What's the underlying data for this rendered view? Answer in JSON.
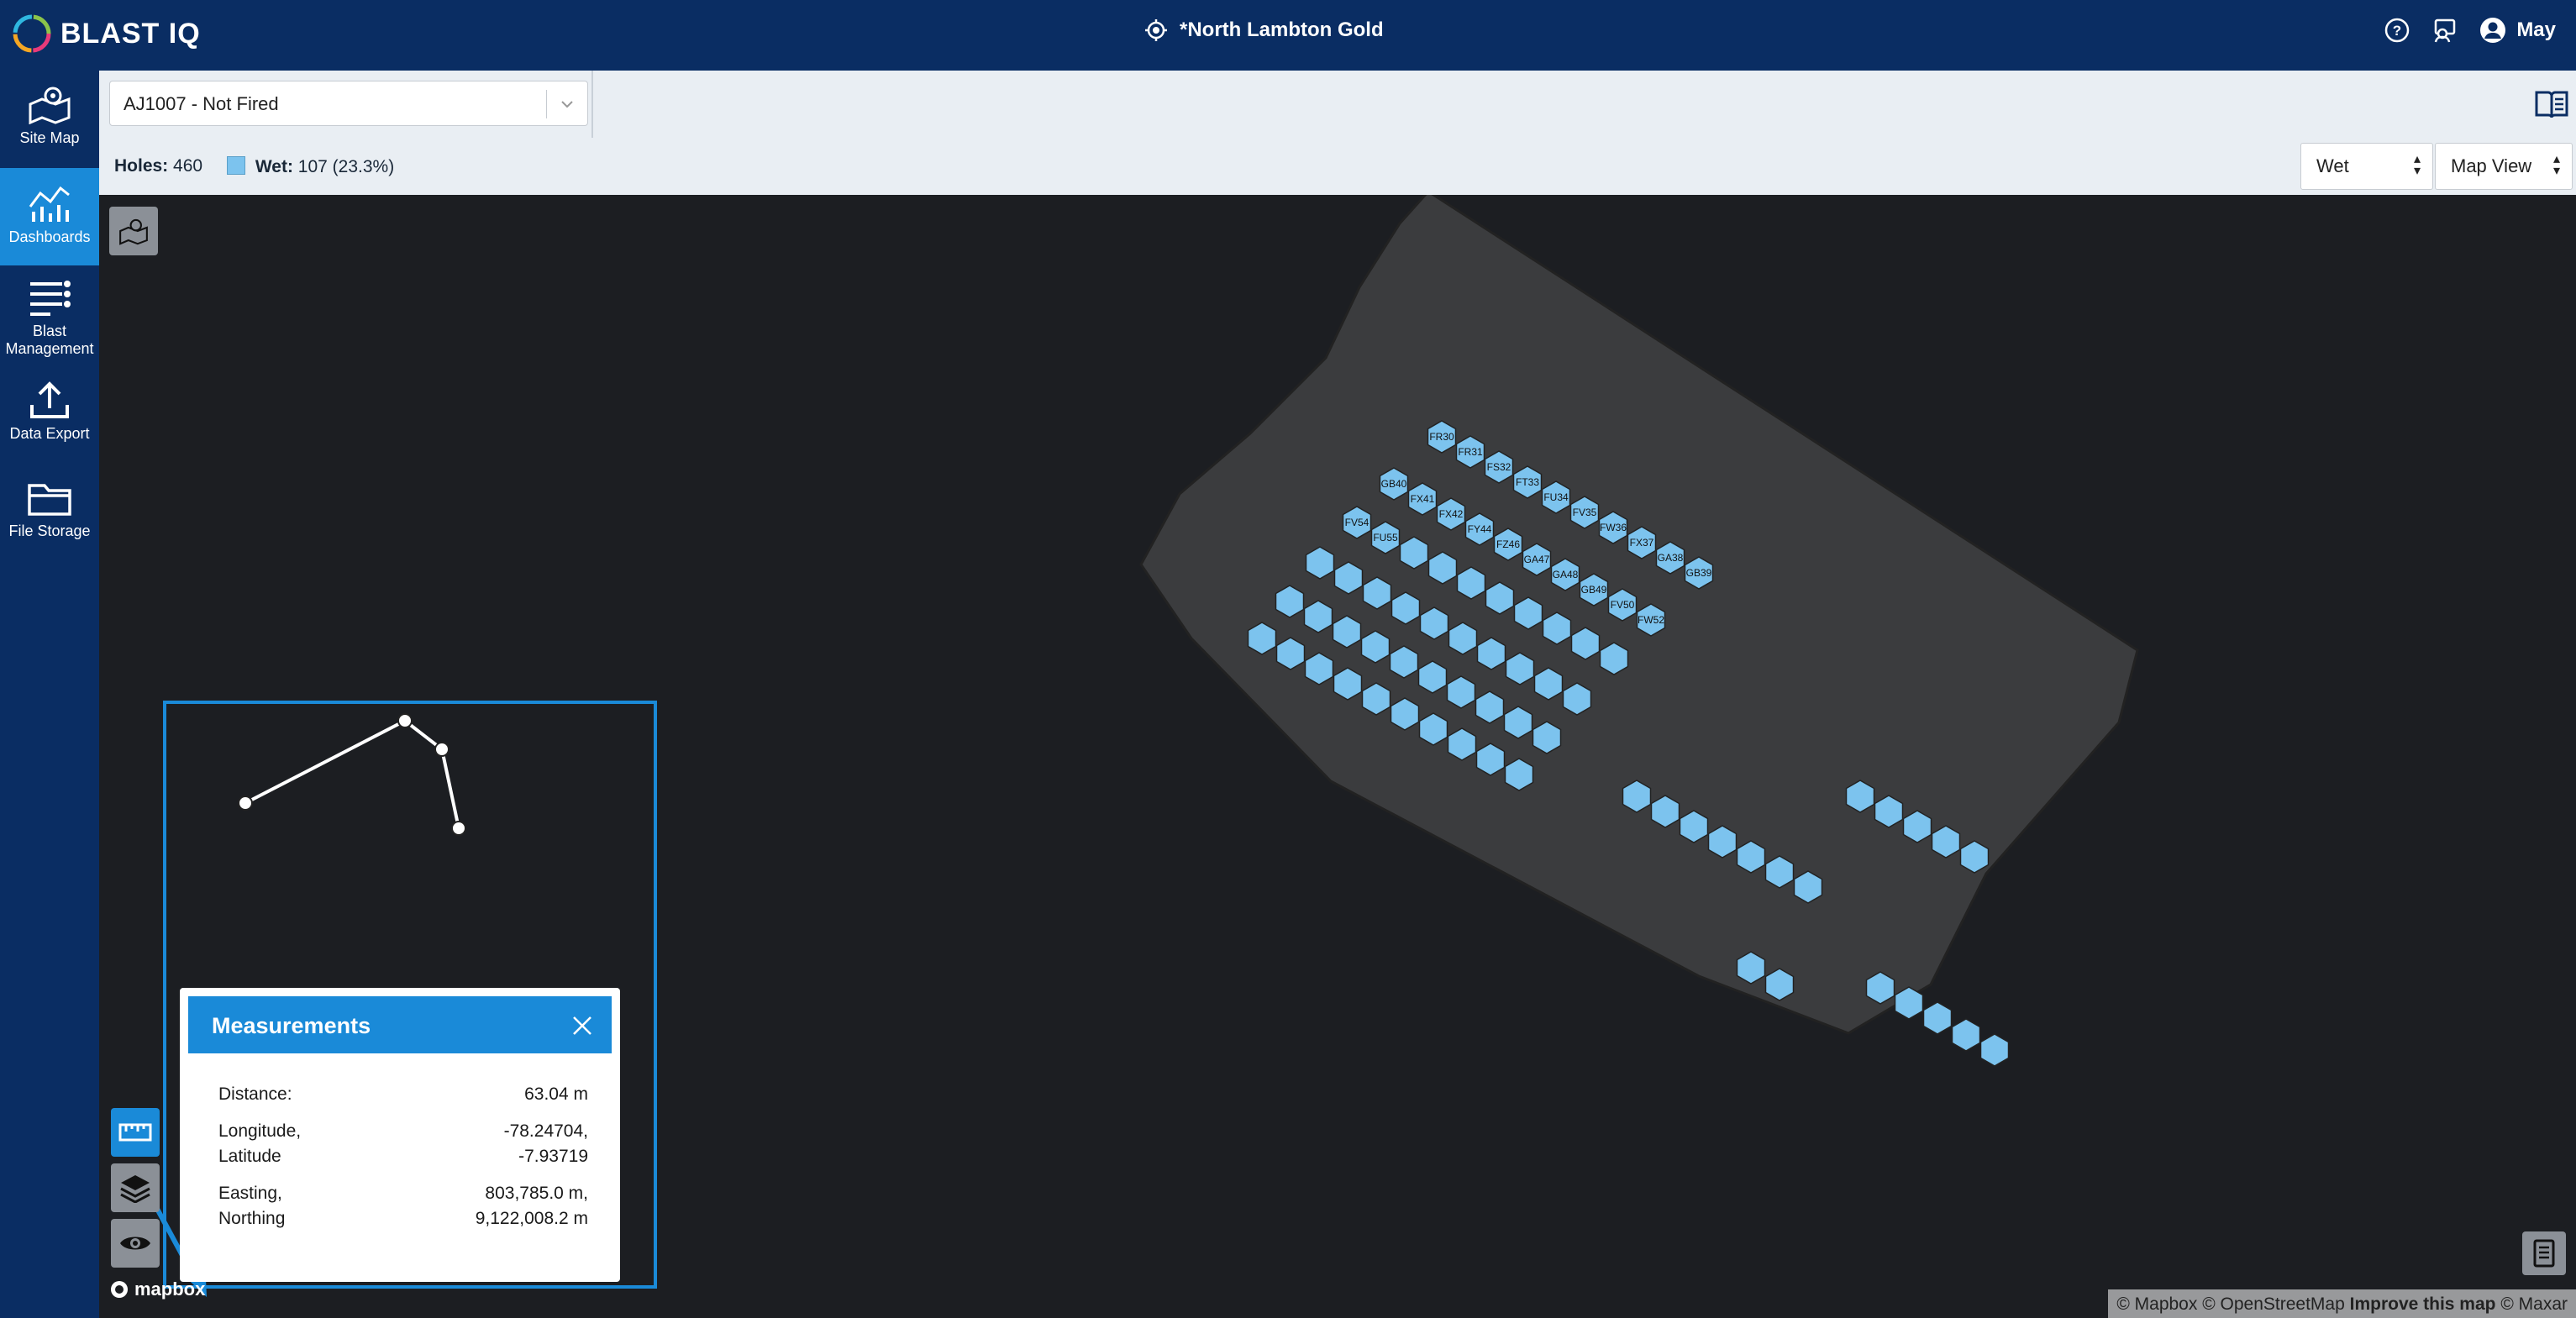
{
  "app": {
    "logo_text": "BLAST IQ",
    "site_title": "*North Lambton Gold",
    "user_name": "May"
  },
  "sidebar": {
    "items": [
      {
        "label": "Site Map",
        "icon": "site-map-icon"
      },
      {
        "label": "Dashboards",
        "icon": "dashboard-icon"
      },
      {
        "label": "Blast Management",
        "icon": "blast-management-icon"
      },
      {
        "label": "Data Export",
        "icon": "upload-icon"
      },
      {
        "label": "File Storage",
        "icon": "folder-icon"
      }
    ]
  },
  "blast_select": {
    "value": "AJ1007 - Not Fired"
  },
  "status": {
    "holes_label": "Holes:",
    "holes_value": "460",
    "wet_label": "Wet:",
    "wet_value": "107 (23.3%)"
  },
  "filters": {
    "attribute": "Wet",
    "view": "Map View"
  },
  "measurements": {
    "title": "Measurements",
    "distance_label": "Distance:",
    "distance_value": "63.04 m",
    "lonlat_label_1": "Longitude,",
    "lonlat_label_2": "Latitude",
    "lon_value": "-78.24704,",
    "lat_value": "-7.93719",
    "en_label_1": "Easting,",
    "en_label_2": "Northing",
    "easting_value": "803,785.0 m,",
    "northing_value": "9,122,008.2 m"
  },
  "map": {
    "mapbox_label": "mapbox",
    "attribution_prefix": "© Mapbox © OpenStreetMap",
    "attribution_link": "Improve this map",
    "attribution_suffix": "© Maxar",
    "hole_label_sample": [
      "FR30",
      "FR31",
      "FS32",
      "FT33",
      "FU34",
      "FV35",
      "FW36",
      "FX37",
      "GA38",
      "GB39",
      "GB40",
      "FX41",
      "FX42",
      "FY44",
      "FZ46",
      "GA47",
      "GA48",
      "GB49",
      "FV50",
      "FW52",
      "FV54",
      "FU55"
    ]
  },
  "colors": {
    "brand": "#0a2d63",
    "accent": "#1a8ad8",
    "wet_hole": "#7cc3ee",
    "dry_hole": "#3b3c3e"
  }
}
